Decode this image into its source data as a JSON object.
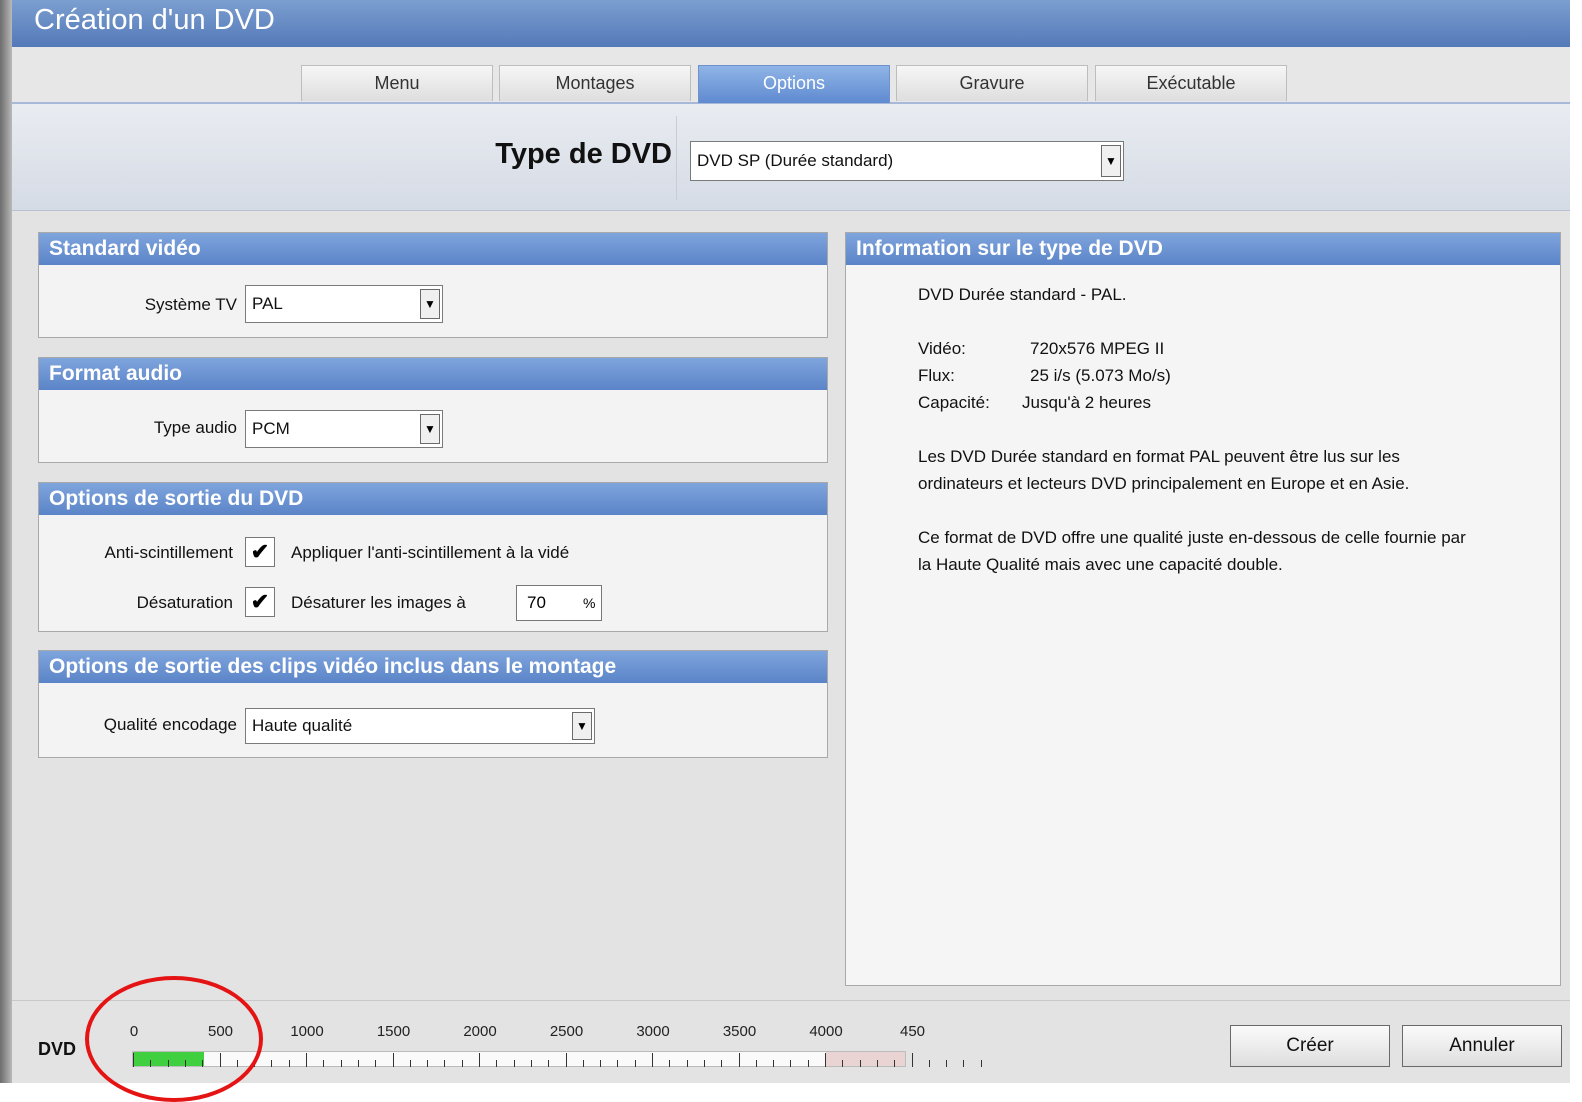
{
  "window": {
    "title": "Création d'un DVD"
  },
  "tabs": [
    {
      "label": "Menu",
      "active": false
    },
    {
      "label": "Montages",
      "active": false
    },
    {
      "label": "Options",
      "active": true
    },
    {
      "label": "Gravure",
      "active": false
    },
    {
      "label": "Exécutable",
      "active": false
    }
  ],
  "dvd_type": {
    "label": "Type de DVD",
    "value": "DVD SP (Durée standard)"
  },
  "standard_video": {
    "title": "Standard vidéo",
    "tv_label": "Système TV",
    "tv_value": "PAL"
  },
  "audio_format": {
    "title": "Format audio",
    "type_label": "Type audio",
    "type_value": "PCM"
  },
  "output_options": {
    "title": "Options de sortie du DVD",
    "antiflicker_label": "Anti-scintillement",
    "antiflicker_checked": true,
    "antiflicker_text": "Appliquer l'anti-scintillement à la vidé",
    "desat_label": "Désaturation",
    "desat_checked": true,
    "desat_text": "Désaturer les images à",
    "desat_value": "70",
    "desat_unit": "%"
  },
  "clips_options": {
    "title": "Options de sortie des clips vidéo inclus dans le montage",
    "quality_label": "Qualité encodage",
    "quality_value": "Haute qualité"
  },
  "info": {
    "title": "Information sur le type de DVD",
    "heading": "DVD Durée standard - PAL.",
    "specs": [
      {
        "key": "Vidéo:",
        "value": "720x576 MPEG II"
      },
      {
        "key": "Flux:",
        "value": "25 i/s (5.073 Mo/s)"
      },
      {
        "key": "Capacité:",
        "value": "Jusqu'à 2 heures"
      }
    ],
    "paragraph1": "Les DVD Durée standard en format PAL peuvent être lus sur les ordinateurs et lecteurs DVD principalement en Europe et en Asie.",
    "paragraph2": "Ce format de DVD offre une qualité juste en-dessous de celle fournie par la Haute Qualité mais avec une capacité double."
  },
  "capacity_bar": {
    "label": "DVD",
    "ticks": [
      "0",
      "500",
      "1000",
      "1500",
      "2000",
      "2500",
      "3000",
      "3500",
      "4000",
      "450"
    ],
    "used_mb": 410,
    "capacity_mb": 4000
  },
  "buttons": {
    "create": "Créer",
    "cancel": "Annuler"
  },
  "colors": {
    "title_bar": "#5479b8",
    "section_header": "#6b93d6",
    "active_tab": "#6f95d7",
    "capacity_fill": "#3fcf3f",
    "annotation_circle": "#e51414"
  }
}
